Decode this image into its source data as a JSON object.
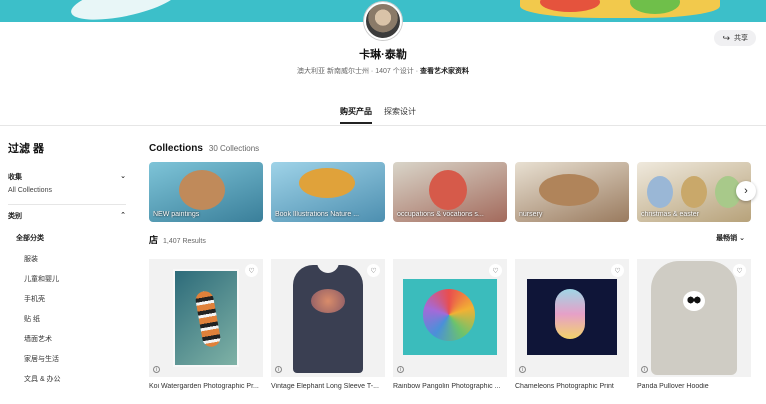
{
  "header": {
    "share_label": "共享",
    "artist_name": "卡琳·泰勒",
    "location": "澳大利亚 新南威尔士州",
    "designs": "1407 个设计",
    "profile_link": "查看艺术家资料"
  },
  "tabs": [
    "购买产品",
    "探索设计"
  ],
  "sidebar": {
    "title": "过滤 器",
    "collections_label": "收集",
    "collections_value": "All Collections",
    "category_label": "类别",
    "all_categories": "全部分类",
    "categories": [
      "服装",
      "儿童和婴儿",
      "手机壳",
      "贴 纸",
      "墙面艺术",
      "家居与生活",
      "文具 & 办公"
    ]
  },
  "collections": {
    "title": "Collections",
    "count": "30 Collections",
    "items": [
      "NEW paintings",
      "Book Illustrations Nature ...",
      "occupations & vocations s...",
      "nursery",
      "christmas & easter"
    ]
  },
  "shop": {
    "title": "店",
    "count": "1,407 Results",
    "sort_label": "最畅销"
  },
  "products": [
    "Koi Watergarden Photographic Pr...",
    "Vintage Elephant Long Sleeve T-...",
    "Rainbow Pangolin Photographic ...",
    "Chameleons Photographic Print",
    "Panda Pullover Hoodie"
  ],
  "icons": {
    "share": "share-icon",
    "heart": "heart-icon",
    "info": "info-icon",
    "chevron": "chevron-down-icon",
    "next": "chevron-right-icon"
  },
  "colors": {
    "banner": "#3cbfc9"
  }
}
